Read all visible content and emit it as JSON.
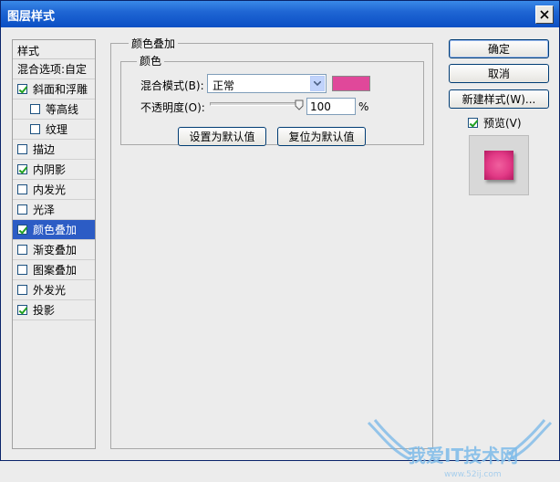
{
  "window": {
    "title": "图层样式"
  },
  "styles": {
    "header": "样式",
    "items": [
      {
        "label": "混合选项:自定",
        "checkbox": false,
        "checked": false,
        "indent": false,
        "selected": false
      },
      {
        "label": "斜面和浮雕",
        "checkbox": true,
        "checked": true,
        "indent": false,
        "selected": false
      },
      {
        "label": "等高线",
        "checkbox": true,
        "checked": false,
        "indent": true,
        "selected": false
      },
      {
        "label": "纹理",
        "checkbox": true,
        "checked": false,
        "indent": true,
        "selected": false
      },
      {
        "label": "描边",
        "checkbox": true,
        "checked": false,
        "indent": false,
        "selected": false
      },
      {
        "label": "内阴影",
        "checkbox": true,
        "checked": true,
        "indent": false,
        "selected": false
      },
      {
        "label": "内发光",
        "checkbox": true,
        "checked": false,
        "indent": false,
        "selected": false
      },
      {
        "label": "光泽",
        "checkbox": true,
        "checked": false,
        "indent": false,
        "selected": false
      },
      {
        "label": "颜色叠加",
        "checkbox": true,
        "checked": true,
        "indent": false,
        "selected": true
      },
      {
        "label": "渐变叠加",
        "checkbox": true,
        "checked": false,
        "indent": false,
        "selected": false
      },
      {
        "label": "图案叠加",
        "checkbox": true,
        "checked": false,
        "indent": false,
        "selected": false
      },
      {
        "label": "外发光",
        "checkbox": true,
        "checked": false,
        "indent": false,
        "selected": false
      },
      {
        "label": "投影",
        "checkbox": true,
        "checked": true,
        "indent": false,
        "selected": false
      }
    ]
  },
  "panel": {
    "title": "颜色叠加",
    "group_title": "颜色",
    "blend_mode_label": "混合模式(B):",
    "blend_mode_value": "正常",
    "overlay_color": "#e0489a",
    "opacity_label": "不透明度(O):",
    "opacity_value": "100",
    "opacity_unit": "%",
    "opacity_level": 1.0,
    "set_default_label": "设置为默认值",
    "reset_default_label": "复位为默认值"
  },
  "buttons": {
    "ok": "确定",
    "cancel": "取消",
    "new_style": "新建样式(W)..."
  },
  "preview": {
    "label": "预览(V)",
    "checked": true
  },
  "watermark": {
    "text": "我爱IT技术网",
    "url": "www.52ij.com"
  }
}
